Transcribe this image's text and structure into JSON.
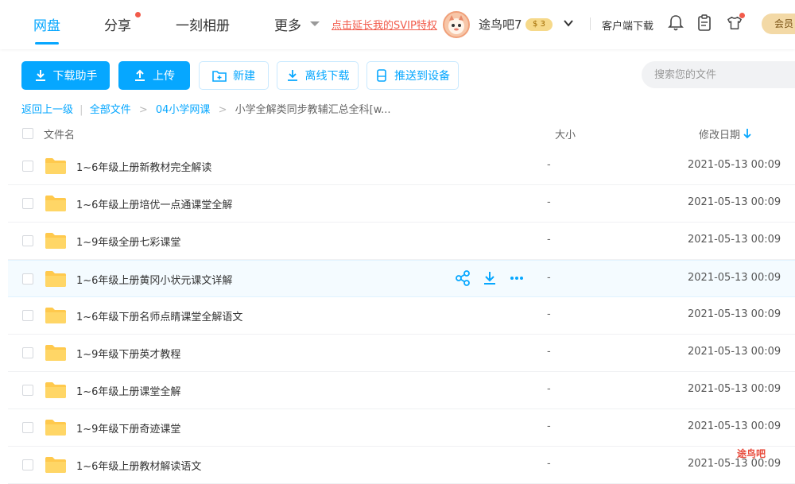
{
  "nav": {
    "items": [
      {
        "label": "网盘"
      },
      {
        "label": "分享"
      },
      {
        "label": "一刻相册"
      },
      {
        "label": "更多"
      }
    ],
    "promo": "点击延长我的SVIP特权",
    "username": "途鸟吧7",
    "vip_level": "3",
    "client_download": "客户端下载",
    "member_button": "会员"
  },
  "toolbar": {
    "download_helper": "下载助手",
    "upload": "上传",
    "new": "新建",
    "offline_download": "离线下载",
    "push_device": "推送到设备",
    "search_placeholder": "搜索您的文件"
  },
  "breadcrumb": {
    "back": "返回上一级",
    "items": [
      "全部文件",
      "04小学网课"
    ],
    "current": "小学全解类同步教辅汇总全科[w..."
  },
  "table": {
    "headers": {
      "name": "文件名",
      "size": "大小",
      "modified": "修改日期"
    },
    "rows": [
      {
        "name": "1~6年级上册新教材完全解读",
        "size": "-",
        "date": "2021-05-13 00:09"
      },
      {
        "name": "1~6年级上册培优一点通课堂全解",
        "size": "-",
        "date": "2021-05-13 00:09"
      },
      {
        "name": "1~9年级全册七彩课堂",
        "size": "-",
        "date": "2021-05-13 00:09"
      },
      {
        "name": "1~6年级上册黄冈小状元课文详解",
        "size": "-",
        "date": "2021-05-13 00:09"
      },
      {
        "name": "1~6年级下册名师点睛课堂全解语文",
        "size": "-",
        "date": "2021-05-13 00:09"
      },
      {
        "name": "1~9年级下册英才教程",
        "size": "-",
        "date": "2021-05-13 00:09"
      },
      {
        "name": "1~6年级上册课堂全解",
        "size": "-",
        "date": "2021-05-13 00:09"
      },
      {
        "name": "1~9年级下册奇迹课堂",
        "size": "-",
        "date": "2021-05-13 00:09"
      },
      {
        "name": "1~6年级上册教材解读语文",
        "size": "-",
        "date": "2021-05-13 00:09"
      }
    ]
  },
  "watermark": "途鸟吧",
  "colors": {
    "accent": "#06a7ff",
    "folder": "#ffc94d",
    "promo": "#f25b4b"
  }
}
